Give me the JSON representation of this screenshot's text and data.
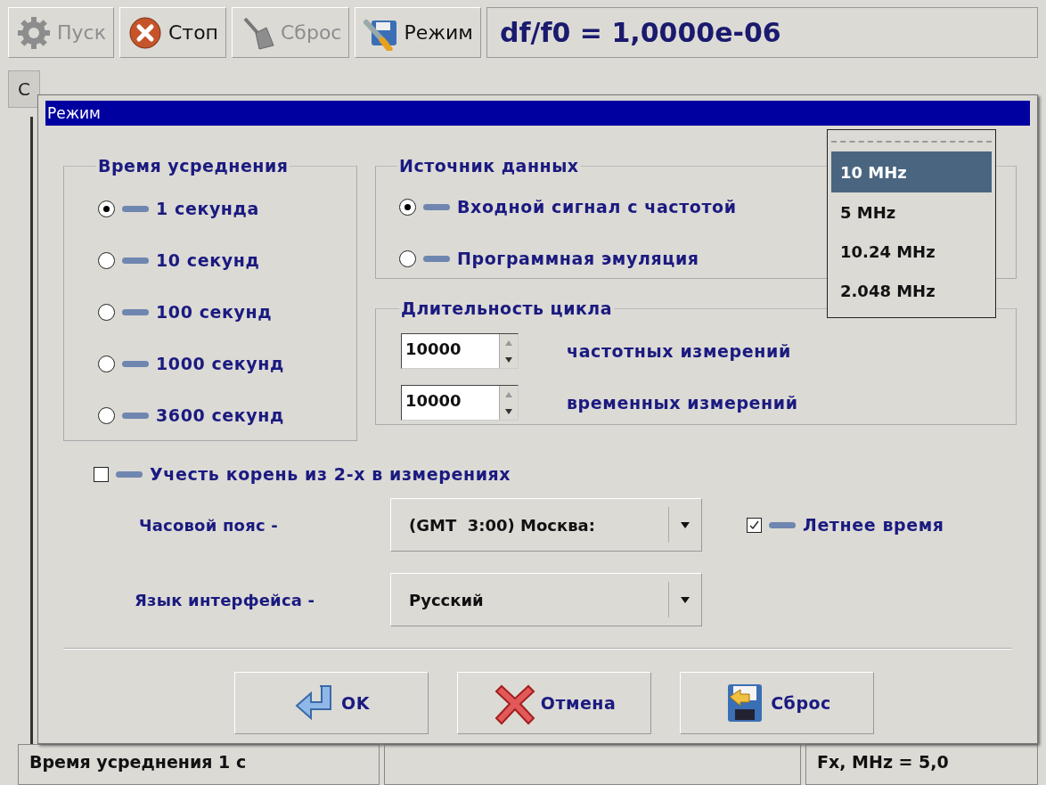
{
  "toolbar": {
    "buttons": [
      {
        "label": "Пуск",
        "kind": "gear",
        "disabled": true
      },
      {
        "label": "Стоп",
        "kind": "stop",
        "disabled": false
      },
      {
        "label": "Сброс",
        "kind": "broom",
        "disabled": true
      },
      {
        "label": "Режим",
        "kind": "mode",
        "disabled": false
      }
    ],
    "readout": "df/f0 = 1,0000e-06"
  },
  "tab_label": "С",
  "dialog": {
    "title": "Режим",
    "averaging": {
      "title": "Время усреднения",
      "options": [
        {
          "label": "1 секунда",
          "selected": true
        },
        {
          "label": "10 секунд",
          "selected": false
        },
        {
          "label": "100 секунд",
          "selected": false
        },
        {
          "label": "1000 секунд",
          "selected": false
        },
        {
          "label": "3600 секунд",
          "selected": false
        }
      ]
    },
    "source": {
      "title": "Источник данных",
      "options": [
        {
          "label": "Входной сигнал с частотой",
          "selected": true
        },
        {
          "label": "Программная эмуляция",
          "selected": false
        }
      ]
    },
    "cycle": {
      "title": "Длительность цикла",
      "rows": [
        {
          "value": "10000",
          "label": "частотных измерений"
        },
        {
          "value": "10000",
          "label": "временных измерений"
        }
      ]
    },
    "sqrt2": {
      "label": "Учесть корень из 2-х в измерениях",
      "checked": false
    },
    "timezone": {
      "label": "Часовой пояс -",
      "value": "(GMT  3:00) Москва:"
    },
    "dst": {
      "label": "Летнее время",
      "checked": true
    },
    "language": {
      "label": "Язык интерфейса -",
      "value": "Русский"
    },
    "buttons": [
      {
        "label": "OK",
        "kind": "ok"
      },
      {
        "label": "Отмена",
        "kind": "cancel"
      },
      {
        "label": "Сброс",
        "kind": "reset"
      }
    ]
  },
  "popup": {
    "items": [
      {
        "label": "10 MHz",
        "selected": true
      },
      {
        "label": "5 MHz",
        "selected": false
      },
      {
        "label": "10.24 MHz",
        "selected": false
      },
      {
        "label": "2.048 MHz",
        "selected": false
      }
    ]
  },
  "status_bar": {
    "left": "Время усреднения 1 с",
    "right": "Fx, MHz = 5,0"
  }
}
